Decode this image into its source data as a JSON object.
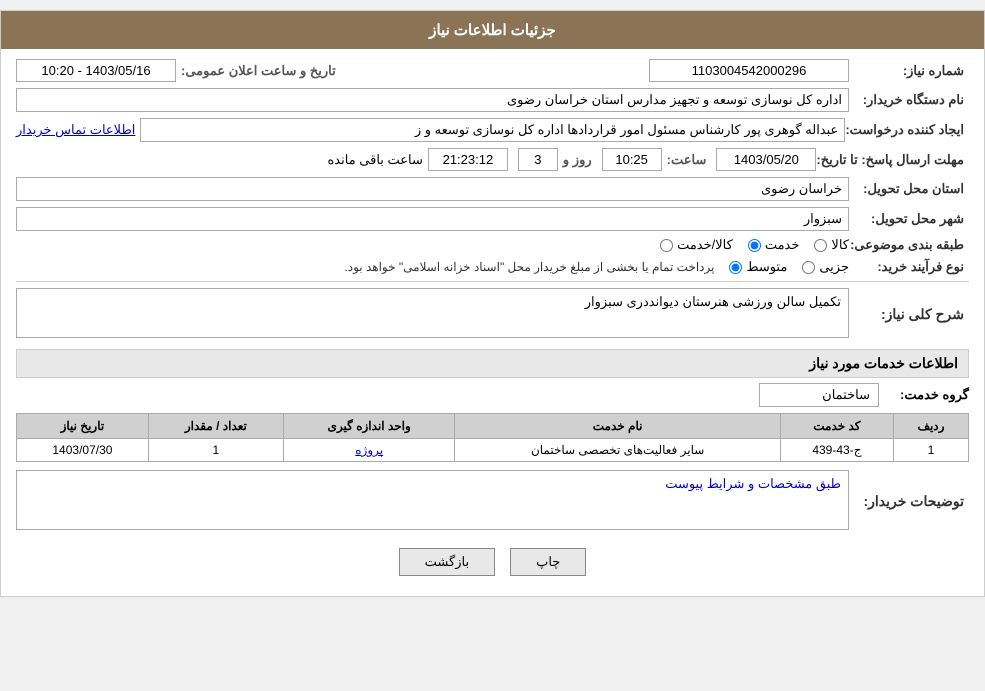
{
  "header": {
    "title": "جزئیات اطلاعات نیاز"
  },
  "fields": {
    "order_number_label": "شماره نیاز:",
    "order_number_value": "1103004542000296",
    "buyer_org_label": "نام دستگاه خریدار:",
    "buyer_org_value": "اداره کل نوسازی  توسعه و تجهیز مدارس استان خراسان رضوی",
    "creator_label": "ایجاد کننده درخواست:",
    "creator_value": "عبداله گوهری پور کارشناس مسئول امور قراردادها  اداره کل نوسازی  توسعه و ز",
    "creator_link": "اطلاعات تماس خریدار",
    "send_date_label": "مهلت ارسال پاسخ: تا تاریخ:",
    "send_date_value": "1403/05/20",
    "send_time_label": "ساعت:",
    "send_time_value": "10:25",
    "send_day_label": "روز و",
    "send_day_value": "3",
    "send_countdown_value": "21:23:12",
    "send_remaining_label": "ساعت باقی مانده",
    "province_label": "استان محل تحویل:",
    "province_value": "خراسان رضوی",
    "city_label": "شهر محل تحویل:",
    "city_value": "سبزوار",
    "category_label": "طبقه بندی موضوعی:",
    "category_options": [
      "کالا",
      "خدمت",
      "کالا/خدمت"
    ],
    "category_selected": "خدمت",
    "purchase_type_label": "نوع فرآیند خرید:",
    "purchase_options": [
      "جزیی",
      "متوسط"
    ],
    "purchase_selected": "متوسط",
    "purchase_note": "پرداخت تمام یا بخشی از مبلغ خریدار محل \"اسناد خزانه اسلامی\" خواهد بود.",
    "announce_date_label": "تاریخ و ساعت اعلان عمومی:",
    "announce_date_value": "1403/05/16 - 10:20",
    "description_section_label": "شرح کلی نیاز:",
    "description_value": "تکمیل سالن ورزشی هنرستان دیوانددری سبزوار",
    "services_section_label": "اطلاعات خدمات مورد نیاز",
    "service_group_label": "گروه خدمت:",
    "service_group_value": "ساختمان",
    "table": {
      "headers": [
        "ردیف",
        "کد خدمت",
        "نام خدمت",
        "واحد اندازه گیری",
        "تعداد / مقدار",
        "تاریخ نیاز"
      ],
      "rows": [
        {
          "row": "1",
          "code": "ج-43-439",
          "name": "سایر فعالیت‌های تخصصی ساختمان",
          "unit": "پروژه",
          "count": "1",
          "date": "1403/07/30"
        }
      ]
    },
    "buyer_notes_label": "توضیحات خریدار:",
    "buyer_notes_value": "طبق مشخصات و شرایط پیوست"
  },
  "buttons": {
    "print_label": "چاپ",
    "back_label": "بازگشت"
  }
}
